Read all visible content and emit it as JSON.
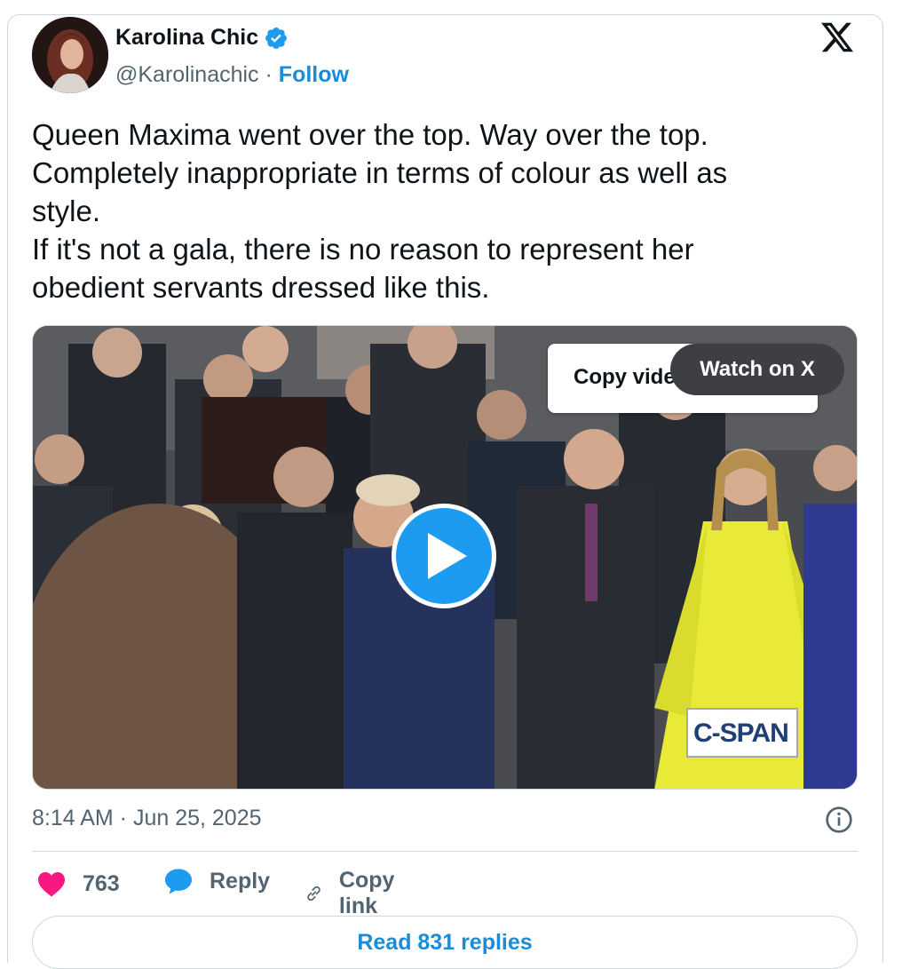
{
  "author": {
    "name": "Karolina Chic",
    "handle": "@Karolinachic",
    "separator": "·",
    "follow_label": "Follow",
    "verified_color": "#1d9bf0"
  },
  "tweet": {
    "lines": [
      "Queen Maxima went over the top. Way over the top.",
      "Completely inappropriate in terms of colour as well as",
      "style.",
      "If it's not a gala, there is no reason to represent her",
      "obedient servants dressed like this."
    ],
    "timestamp": "8:14 AM · Jun 25, 2025"
  },
  "media": {
    "copy_video_label": "Copy video",
    "watch_label": "Watch on X",
    "watermark": "C-SPAN",
    "play_icon": "play-icon"
  },
  "actions": {
    "likes_count": "763",
    "reply_label": "Reply",
    "copy_link_label": "Copy link",
    "like_color": "#f91880",
    "reply_color": "#1d9bf0"
  },
  "read_replies_label": "Read 831 replies",
  "icons": [
    "x-logo-icon",
    "verified-badge-icon",
    "info-icon",
    "heart-icon",
    "reply-bubble-icon",
    "link-icon"
  ]
}
